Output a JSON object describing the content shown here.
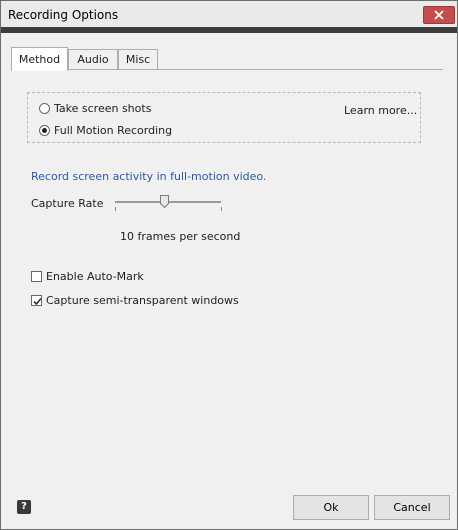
{
  "window": {
    "title": "Recording Options"
  },
  "tabs": [
    {
      "label": "Method"
    },
    {
      "label": "Audio"
    },
    {
      "label": "Misc"
    }
  ],
  "method": {
    "options": [
      {
        "label": "Take screen shots",
        "selected": false
      },
      {
        "label": "Full Motion Recording",
        "selected": true
      }
    ],
    "learn_more": "Learn more...",
    "description": "Record screen activity in full-motion video.",
    "capture_rate_label": "Capture Rate",
    "capture_rate_value": "10 frames per second",
    "slider_level": 0.45,
    "checkboxes": [
      {
        "label": "Enable Auto-Mark",
        "checked": false
      },
      {
        "label": "Capture semi-transparent windows",
        "checked": true
      }
    ]
  },
  "footer": {
    "help_glyph": "?",
    "ok_label": "Ok",
    "cancel_label": "Cancel"
  },
  "colors": {
    "close_button": "#c74d4d",
    "description_text": "#2a59a8",
    "title_divider": "#3c3c3c"
  },
  "icons": [
    "close-icon",
    "help-icon",
    "checkmark-icon",
    "slider-thumb"
  ]
}
